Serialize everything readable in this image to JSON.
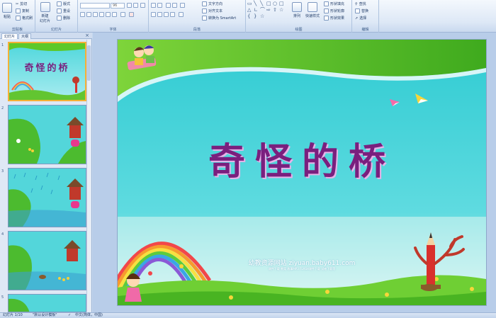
{
  "ribbon": {
    "clipboard": {
      "label": "剪贴板",
      "paste": "粘贴",
      "cut": "剪切",
      "copy": "复制",
      "format_painter": "格式刷"
    },
    "slides": {
      "label": "幻灯片",
      "new_slide": "新建\n幻灯片",
      "layout": "版式",
      "reset": "重设",
      "delete": "删除"
    },
    "font": {
      "label": "字体",
      "font_size": "96"
    },
    "paragraph": {
      "label": "段落",
      "text_direction": "文字方向",
      "align_text": "对齐文本",
      "smartart": "转换为 SmartArt"
    },
    "drawing": {
      "label": "绘图",
      "arrange": "排列",
      "quick_styles": "快速样式",
      "shape_fill": "形状填充",
      "shape_outline": "形状轮廓",
      "shape_effects": "形状效果"
    },
    "editing": {
      "label": "编辑",
      "find": "查找",
      "replace": "替换",
      "select": "选择"
    }
  },
  "left_pane": {
    "tabs": [
      "幻灯片",
      "大纲"
    ],
    "close": "×",
    "slide_numbers": [
      "1",
      "2",
      "3",
      "4",
      "5"
    ]
  },
  "slide": {
    "title": "奇怪的桥",
    "site_name": "幼教资源网站  ziyuan.baby611.com",
    "site_links": "课件下载  教案  故事MP3  FLASH课件下载  试卷下载等"
  },
  "status_bar": {
    "slide_pos": "幻灯片 1/10",
    "theme": "\"默认设计模板\"",
    "language": "中文(简体，中国)"
  },
  "colors": {
    "title": "#7a1f7e",
    "sky": "#3fd3d6",
    "grass": "#5cc82a",
    "ribbon_bg": "#dde8f6",
    "selected_thumb": "#f5b136"
  }
}
